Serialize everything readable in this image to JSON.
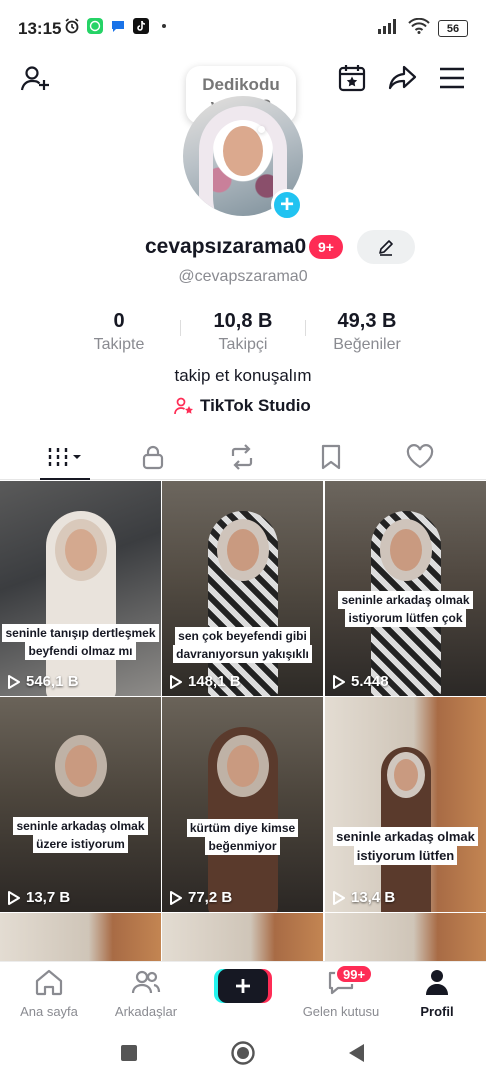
{
  "status_bar": {
    "time": "13:15",
    "battery": "56",
    "left_icons": [
      "alarm-icon",
      "whatsapp-icon",
      "messages-icon",
      "tiktok-icon",
      "dot-icon"
    ],
    "right_icons": [
      "signal-icon",
      "wifi-icon",
      "battery-icon"
    ]
  },
  "header": {
    "bubble_text_line1": "Dedikodu",
    "bubble_text_line2": "var mı?",
    "icons": [
      "add-friend-icon",
      "calendar-star-icon",
      "share-icon",
      "menu-icon"
    ]
  },
  "profile": {
    "username": "cevapsızarama0",
    "notification_badge": "9+",
    "handle": "@cevapszarama0",
    "bio": "takip et konuşalım",
    "studio_link": "TikTok Studio",
    "stats": [
      {
        "value": "0",
        "label": "Takipte"
      },
      {
        "value": "10,8 B",
        "label": "Takipçi"
      },
      {
        "value": "49,3 B",
        "label": "Beğeniler"
      }
    ]
  },
  "tabs": [
    "videos-grid-icon",
    "lock-icon",
    "repost-icon",
    "bookmark-icon",
    "heart-icon"
  ],
  "videos": [
    {
      "caption": "seninle tanışıp dertleşmek beyfendi olmaz mı",
      "views": "546,1 B"
    },
    {
      "caption": "sen çok beyefendi gibi davranıyorsun yakışıklı",
      "views": "148,1 B"
    },
    {
      "caption": "seninle arkadaş olmak istiyorum lütfen çok",
      "views": "5.448"
    },
    {
      "caption": "seninle arkadaş olmak üzere istiyorum",
      "views": "13,7 B"
    },
    {
      "caption": "kürtüm diye kimse beğenmiyor",
      "views": "77,2 B"
    },
    {
      "caption": "seninle arkadaş olmak istiyorum lütfen",
      "views": "13,4 B"
    }
  ],
  "bottom_nav": {
    "items": [
      {
        "label": "Ana sayfa"
      },
      {
        "label": "Arkadaşlar"
      },
      {
        "label": "Gelen kutusu"
      },
      {
        "label": "Profil"
      }
    ],
    "inbox_badge": "99+"
  },
  "colors": {
    "accent_red": "#fe2c55",
    "accent_cyan": "#25f4ee",
    "add_blue": "#21c3f1",
    "text_dark": "#161823",
    "text_gray": "#8a8b91"
  }
}
